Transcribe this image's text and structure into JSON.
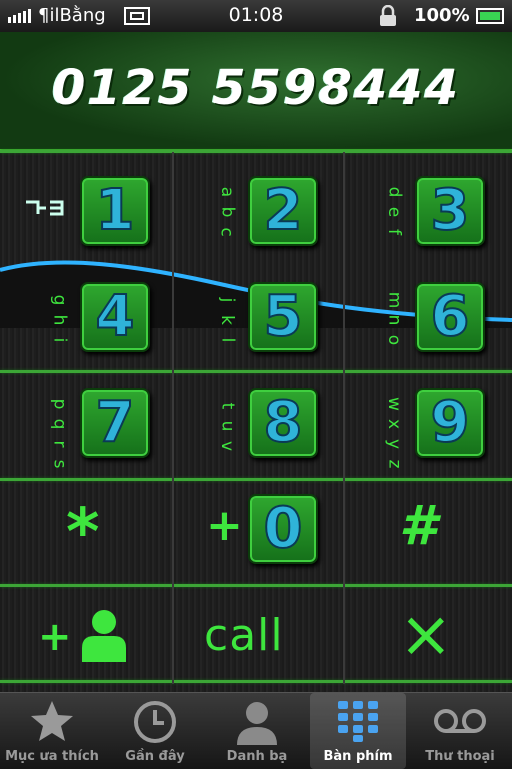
{
  "status": {
    "carrier": "¶ilBằng",
    "time": "01:08",
    "battery": "100%"
  },
  "dialer": {
    "number": "0125 5598444"
  },
  "keys": [
    {
      "digit": "1",
      "letters": []
    },
    {
      "digit": "2",
      "letters": [
        "a",
        "b",
        "c"
      ]
    },
    {
      "digit": "3",
      "letters": [
        "d",
        "e",
        "f"
      ]
    },
    {
      "digit": "4",
      "letters": [
        "g",
        "h",
        "i"
      ]
    },
    {
      "digit": "5",
      "letters": [
        "j",
        "k",
        "l"
      ]
    },
    {
      "digit": "6",
      "letters": [
        "m",
        "n",
        "o"
      ]
    },
    {
      "digit": "7",
      "letters": [
        "p",
        "q",
        "r",
        "s"
      ]
    },
    {
      "digit": "8",
      "letters": [
        "t",
        "u",
        "v"
      ]
    },
    {
      "digit": "9",
      "letters": [
        "w",
        "x",
        "y",
        "z"
      ]
    },
    {
      "digit": "0",
      "letters": []
    }
  ],
  "symbols": {
    "star": "*",
    "plus": "+",
    "hash": "#",
    "add_plus": "+",
    "call": "call",
    "delete": "×"
  },
  "tabs": [
    {
      "label": "Mục ưa thích",
      "icon": "star-icon"
    },
    {
      "label": "Gần đây",
      "icon": "clock-icon"
    },
    {
      "label": "Danh bạ",
      "icon": "contacts-icon"
    },
    {
      "label": "Bàn phím",
      "icon": "keypad-icon",
      "selected": true
    },
    {
      "label": "Thư thoại",
      "icon": "voicemail-icon"
    }
  ],
  "colors": {
    "accent_green": "#3ee63e",
    "digit_blue": "#2fb3d9",
    "key_green": "#15701a"
  }
}
